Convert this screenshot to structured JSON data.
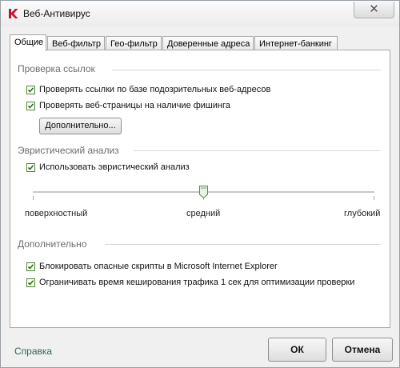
{
  "window": {
    "title": "Веб-Антивирус",
    "close_glyph": "✕",
    "app_icon": "kaspersky-k-icon",
    "accent_red": "#c8102e"
  },
  "tabs": [
    {
      "label": "Общие",
      "active": true
    },
    {
      "label": "Веб-фильтр",
      "active": false
    },
    {
      "label": "Гео-фильтр",
      "active": false
    },
    {
      "label": "Доверенные адреса",
      "active": false
    },
    {
      "label": "Интернет-банкинг",
      "active": false
    }
  ],
  "link_check": {
    "title": "Проверка ссылок",
    "options": [
      {
        "label": "Проверять ссылки по базе подозрительных веб-адресов",
        "checked": true
      },
      {
        "label": "Проверять веб-страницы на наличие фишинга",
        "checked": true
      }
    ],
    "more_button": "Дополнительно..."
  },
  "heuristic": {
    "title": "Эвристический анализ",
    "option": {
      "label": "Использовать эвристический анализ",
      "checked": true
    },
    "slider": {
      "labels": [
        "поверхностный",
        "средний",
        "глубокий"
      ],
      "selected": "средний"
    }
  },
  "additional": {
    "title": "Дополнительно",
    "options": [
      {
        "label": "Блокировать опасные скрипты в Microsoft Internet Explorer",
        "checked": true
      },
      {
        "label": "Ограничивать время кеширования трафика 1 сек для оптимизации проверки",
        "checked": true
      }
    ]
  },
  "footer": {
    "help_link": "Справка",
    "ok_button": "ОК",
    "cancel_button": "Отмена",
    "link_color": "#2d6b4b"
  }
}
